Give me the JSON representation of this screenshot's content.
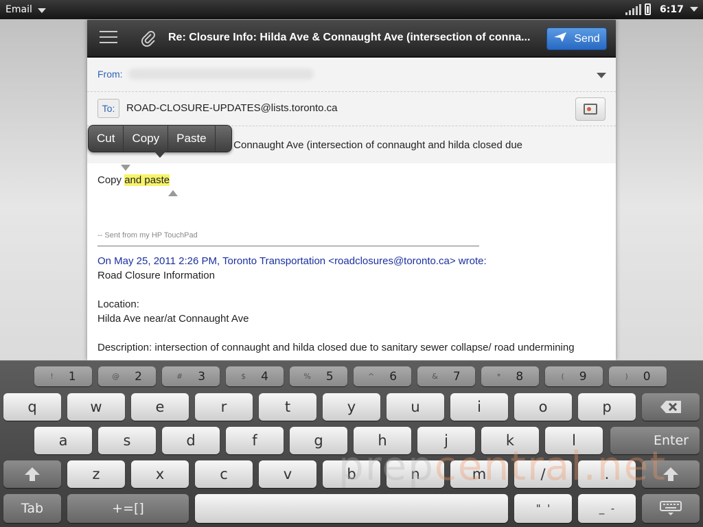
{
  "status_bar": {
    "app_name": "Email",
    "time": "6:17"
  },
  "compose": {
    "header_subject": "Re: Closure Info: Hilda Ave & Connaught Ave (intersection of conna...",
    "send_label": "Send",
    "from_label": "From:",
    "to_label": "To:",
    "to_address": "ROAD-CLOSURE-UPDATES@lists.toronto.ca",
    "subject_field": "Re: Closure Info: Hilda Ave & Connaught Ave (intersection of connaught and hilda closed due",
    "body_plain": "Copy ",
    "body_selected": "and paste",
    "signature": "-- Sent from my HP TouchPad",
    "quote_header": "On May 25, 2011 2:26 PM, Toronto Transportation <roadclosures@toronto.ca> wrote:",
    "quote_lines": [
      "Road Closure Information",
      "",
      "Location:",
      "Hilda Ave near/at Connaught Ave",
      "",
      "Description: intersection of connaught and hilda closed due to sanitary sewer collapse/ road undermining"
    ]
  },
  "edit_menu": {
    "cut": "Cut",
    "copy": "Copy",
    "paste": "Paste"
  },
  "keyboard": {
    "number_row": [
      {
        "sub": "!",
        "main": "1"
      },
      {
        "sub": "@",
        "main": "2"
      },
      {
        "sub": "#",
        "main": "3"
      },
      {
        "sub": "$",
        "main": "4"
      },
      {
        "sub": "%",
        "main": "5"
      },
      {
        "sub": "^",
        "main": "6"
      },
      {
        "sub": "&",
        "main": "7"
      },
      {
        "sub": "*",
        "main": "8"
      },
      {
        "sub": "(",
        "main": "9"
      },
      {
        "sub": ")",
        "main": "0"
      }
    ],
    "row1": [
      "q",
      "w",
      "e",
      "r",
      "t",
      "y",
      "u",
      "i",
      "o",
      "p"
    ],
    "row2": [
      "a",
      "s",
      "d",
      "f",
      "g",
      "h",
      "j",
      "k",
      "l"
    ],
    "row3": [
      "z",
      "x",
      "c",
      "v",
      "b",
      "n",
      "m",
      "/",
      "."
    ],
    "enter": "Enter",
    "tab": "Tab",
    "symbols": "+=[]",
    "quote_key": "\"  '",
    "dash_key": "_  -"
  },
  "watermark": {
    "part1": "prep",
    "part2": "central.net"
  },
  "icons": [
    "menu-icon",
    "paperclip-icon",
    "send-plane-icon",
    "dropdown-triangle-icon",
    "contact-card-icon",
    "backspace-icon",
    "shift-icon",
    "keyboard-hide-icon",
    "signal-icon",
    "battery-icon"
  ]
}
